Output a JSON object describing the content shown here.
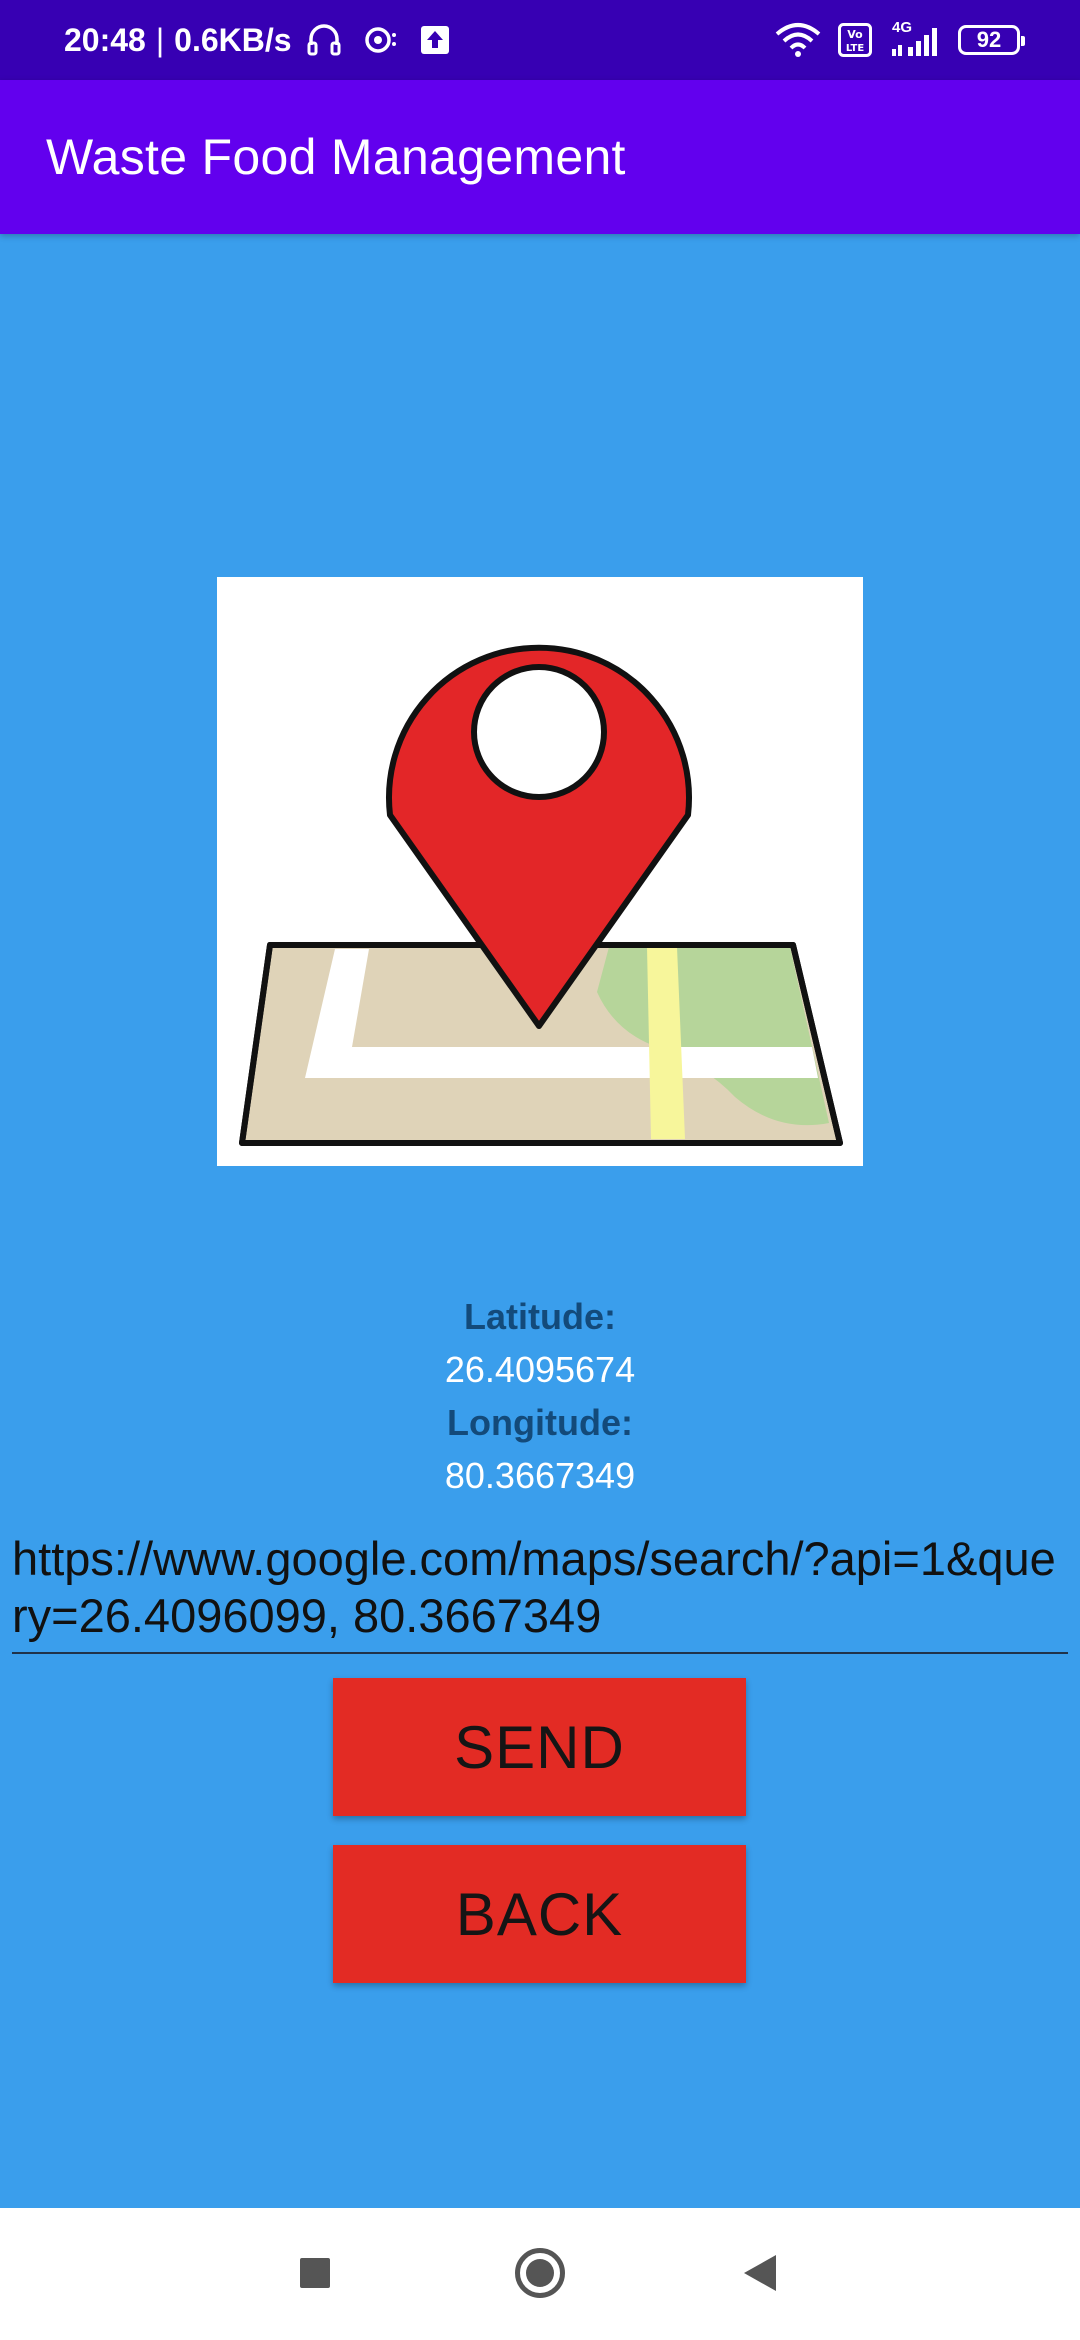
{
  "status_bar": {
    "time": "20:48",
    "separator": "|",
    "speed": "0.6KB/s",
    "network_type": "4G",
    "battery": "92",
    "icons": [
      "headphones-icon",
      "hotspot-icon",
      "upload-icon",
      "wifi-icon",
      "volte-icon",
      "signal-icon",
      "battery-icon"
    ]
  },
  "app_bar": {
    "title": "Waste Food Management"
  },
  "map_image": {
    "icon": "map-location-pin-icon"
  },
  "location": {
    "latitude_label": "Latitude:",
    "latitude_value": "26.4095674",
    "longitude_label": "Longitude:",
    "longitude_value": "80.3667349"
  },
  "link_field": {
    "value": "https://www.google.com/maps/search/?api=1&query=26.4096099, 80.3667349"
  },
  "buttons": {
    "send_label": "SEND",
    "back_label": "BACK"
  },
  "colors": {
    "status_bar": "#3700b3",
    "app_bar": "#6200ee",
    "background": "#3a9eec",
    "button": "#e32b24",
    "label": "#134a7a"
  },
  "nav_bar": {
    "icons": [
      "recents-icon",
      "home-icon",
      "back-icon"
    ]
  }
}
